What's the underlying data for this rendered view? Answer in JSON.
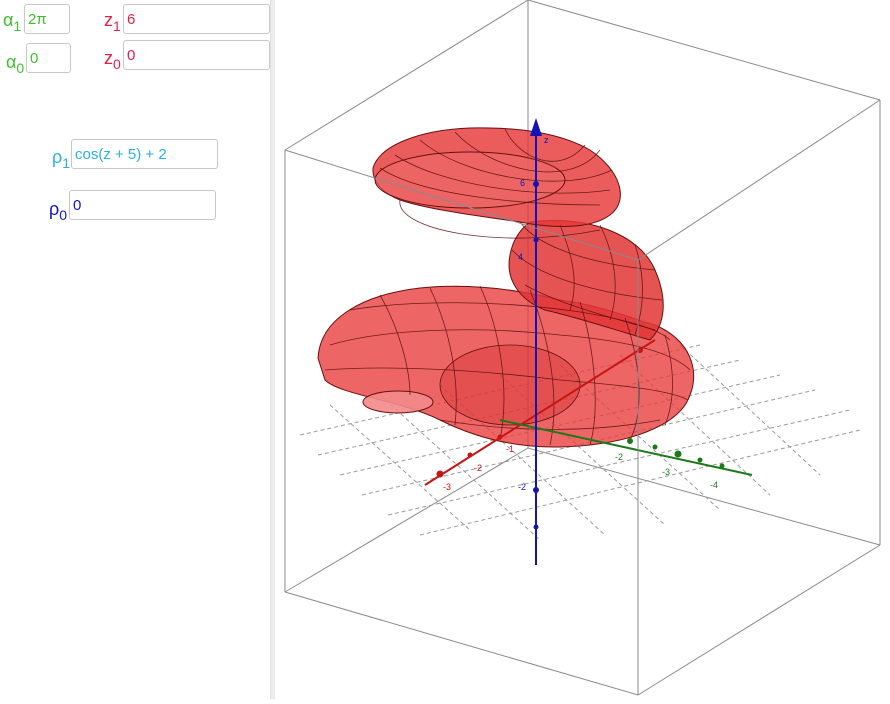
{
  "sliders": {
    "alpha1": {
      "symbol": "α",
      "index": "1",
      "value": "2π",
      "color": "#3fbf2e"
    },
    "alpha0": {
      "symbol": "α",
      "index": "0",
      "value": "0",
      "color": "#3fbf2e"
    },
    "z1": {
      "symbol": "z",
      "index": "1",
      "value": "6",
      "color": "#e0204a"
    },
    "z0": {
      "symbol": "z",
      "index": "0",
      "value": "0",
      "color": "#e0204a"
    },
    "rho1": {
      "symbol": "ρ",
      "index": "1",
      "value": "cos(z + 5) + 2",
      "color": "#2ab0e0"
    },
    "rho0": {
      "symbol": "ρ",
      "index": "0",
      "value": "0",
      "color": "#1414c0"
    }
  },
  "axes": {
    "x_color": "#c81414",
    "y_color": "#1a7a1a",
    "z_color": "#1414b4",
    "x_ticks": [
      "-3",
      "-2",
      "-1"
    ],
    "y_ticks": [
      "-2",
      "-3",
      "-4"
    ],
    "z_ticks": [
      "-2",
      "4",
      "6",
      "z"
    ]
  },
  "surface": {
    "color": "#e83030"
  }
}
